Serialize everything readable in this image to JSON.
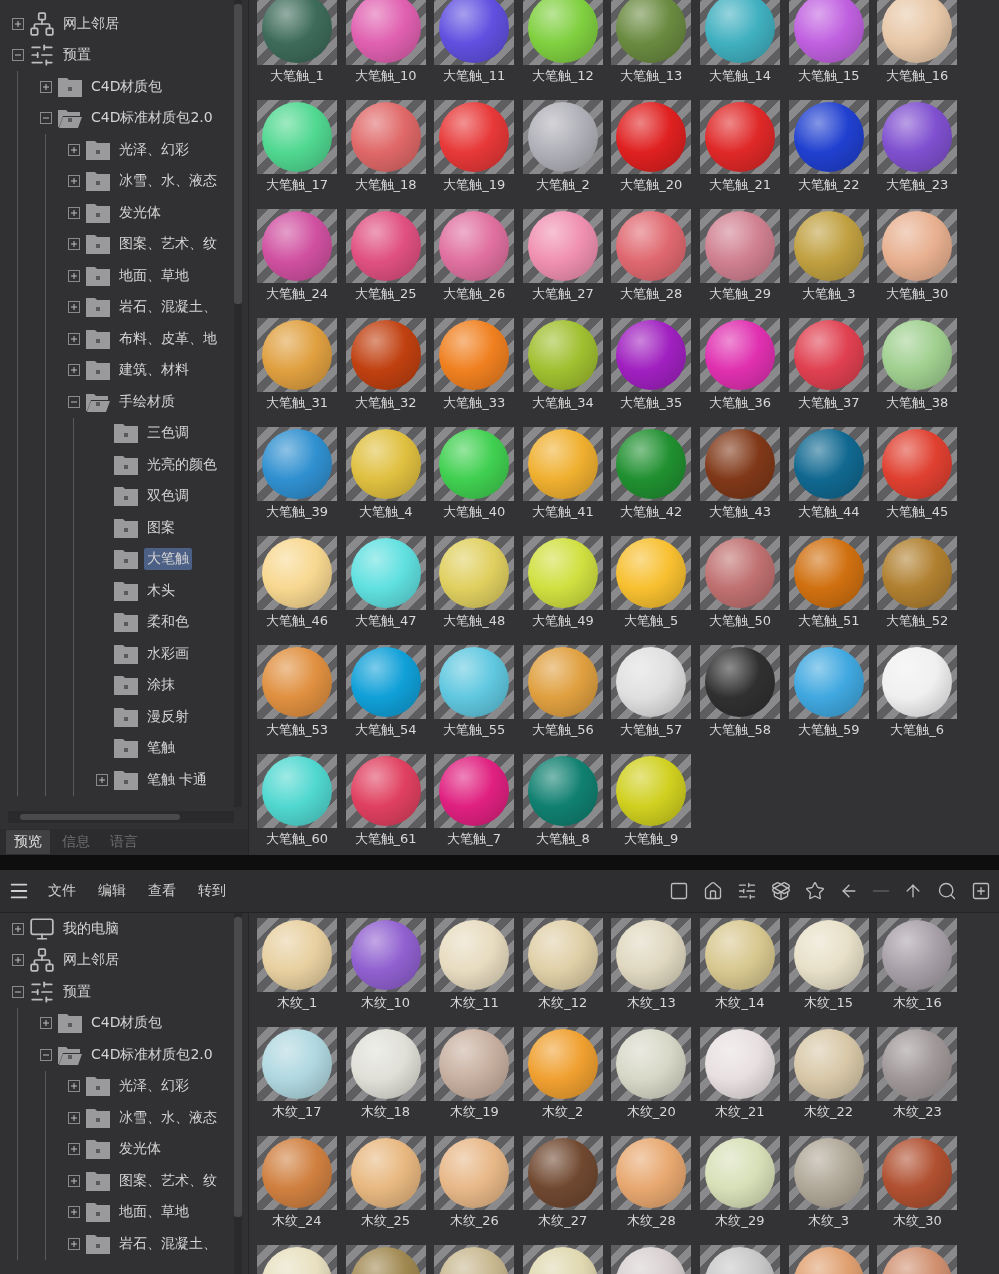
{
  "top_panel": {
    "tree": [
      {
        "label": "网上邻居",
        "kind": "network",
        "expanded": false,
        "selected": false
      },
      {
        "label": "预置",
        "kind": "presets",
        "expanded": true,
        "selected": false,
        "children": [
          {
            "label": "C4D材质包",
            "kind": "folder",
            "expanded": false,
            "selected": false
          },
          {
            "label": "C4D标准材质包2.0",
            "kind": "folder",
            "expanded": true,
            "selected": false,
            "children": [
              {
                "label": "光泽、幻彩",
                "kind": "folder",
                "expanded": false,
                "selected": false
              },
              {
                "label": "冰雪、水、液态",
                "kind": "folder",
                "expanded": false,
                "selected": false
              },
              {
                "label": "发光体",
                "kind": "folder",
                "expanded": false,
                "selected": false
              },
              {
                "label": "图案、艺术、纹",
                "kind": "folder",
                "expanded": false,
                "selected": false
              },
              {
                "label": "地面、草地",
                "kind": "folder",
                "expanded": false,
                "selected": false
              },
              {
                "label": "岩石、混凝土、",
                "kind": "folder",
                "expanded": false,
                "selected": false
              },
              {
                "label": "布料、皮革、地",
                "kind": "folder",
                "expanded": false,
                "selected": false
              },
              {
                "label": "建筑、材料",
                "kind": "folder",
                "expanded": false,
                "selected": false
              },
              {
                "label": "手绘材质",
                "kind": "folder",
                "expanded": true,
                "selected": false,
                "children": [
                  {
                    "label": "三色调",
                    "kind": "folder",
                    "selected": false
                  },
                  {
                    "label": "光亮的颜色",
                    "kind": "folder",
                    "selected": false
                  },
                  {
                    "label": "双色调",
                    "kind": "folder",
                    "selected": false
                  },
                  {
                    "label": "图案",
                    "kind": "folder",
                    "selected": false
                  },
                  {
                    "label": "大笔触",
                    "kind": "folder",
                    "selected": true
                  },
                  {
                    "label": "木头",
                    "kind": "folder",
                    "selected": false
                  },
                  {
                    "label": "柔和色",
                    "kind": "folder",
                    "selected": false
                  },
                  {
                    "label": "水彩画",
                    "kind": "folder",
                    "selected": false
                  },
                  {
                    "label": "涂抹",
                    "kind": "folder",
                    "selected": false
                  },
                  {
                    "label": "漫反射",
                    "kind": "folder",
                    "selected": false
                  },
                  {
                    "label": "笔触",
                    "kind": "folder",
                    "selected": false
                  },
                  {
                    "label": "笔触 卡通",
                    "kind": "folder",
                    "expanded": false,
                    "selected": false
                  }
                ]
              }
            ]
          }
        ]
      }
    ],
    "tabs": [
      {
        "label": "预览",
        "selected": true
      },
      {
        "label": "信息",
        "selected": false
      },
      {
        "label": "语言",
        "selected": false
      }
    ],
    "materials": [
      {
        "label": "大笔触_1",
        "color": "#3d6b5a"
      },
      {
        "label": "大笔触_10",
        "color": "#e060b0"
      },
      {
        "label": "大笔触_11",
        "color": "#6050e0"
      },
      {
        "label": "大笔触_12",
        "color": "#80d040"
      },
      {
        "label": "大笔触_13",
        "color": "#6a8a40"
      },
      {
        "label": "大笔触_14",
        "color": "#40b0c0"
      },
      {
        "label": "大笔触_15",
        "color": "#c060e0"
      },
      {
        "label": "大笔触_16",
        "color": "#e8c8a8"
      },
      {
        "label": "大笔触_17",
        "color": "#50d890"
      },
      {
        "label": "大笔触_18",
        "color": "#e06868"
      },
      {
        "label": "大笔触_19",
        "color": "#e83838"
      },
      {
        "label": "大笔触_2",
        "color": "#b0b0b8"
      },
      {
        "label": "大笔触_20",
        "color": "#e02020"
      },
      {
        "label": "大笔触_21",
        "color": "#e02828"
      },
      {
        "label": "大笔触_22",
        "color": "#2040d0"
      },
      {
        "label": "大笔触_23",
        "color": "#8050d0"
      },
      {
        "label": "大笔触_24",
        "color": "#d050a0"
      },
      {
        "label": "大笔触_25",
        "color": "#e05080"
      },
      {
        "label": "大笔触_26",
        "color": "#e070a0"
      },
      {
        "label": "大笔触_27",
        "color": "#f090b0"
      },
      {
        "label": "大笔触_28",
        "color": "#e06870"
      },
      {
        "label": "大笔触_29",
        "color": "#d08090"
      },
      {
        "label": "大笔触_3",
        "color": "#c0a040"
      },
      {
        "label": "大笔触_30",
        "color": "#e8b090"
      },
      {
        "label": "大笔触_31",
        "color": "#e0a040"
      },
      {
        "label": "大笔触_32",
        "color": "#c04010"
      },
      {
        "label": "大笔触_33",
        "color": "#f08020"
      },
      {
        "label": "大笔触_34",
        "color": "#a0c030"
      },
      {
        "label": "大笔触_35",
        "color": "#a020c0"
      },
      {
        "label": "大笔触_36",
        "color": "#e030b0"
      },
      {
        "label": "大笔触_37",
        "color": "#e04050"
      },
      {
        "label": "大笔触_38",
        "color": "#a0d090"
      },
      {
        "label": "大笔触_39",
        "color": "#3090d0"
      },
      {
        "label": "大笔触_4",
        "color": "#e0c040"
      },
      {
        "label": "大笔触_40",
        "color": "#40d050"
      },
      {
        "label": "大笔触_41",
        "color": "#f0b030"
      },
      {
        "label": "大笔触_42",
        "color": "#209030"
      },
      {
        "label": "大笔触_43",
        "color": "#803818"
      },
      {
        "label": "大笔触_44",
        "color": "#106890"
      },
      {
        "label": "大笔触_45",
        "color": "#e04030"
      },
      {
        "label": "大笔触_46",
        "color": "#f8d890"
      },
      {
        "label": "大笔触_47",
        "color": "#60e0e0"
      },
      {
        "label": "大笔触_48",
        "color": "#e0d060"
      },
      {
        "label": "大笔触_49",
        "color": "#d0e040"
      },
      {
        "label": "大笔触_5",
        "color": "#f8c030"
      },
      {
        "label": "大笔触_50",
        "color": "#c07070"
      },
      {
        "label": "大笔触_51",
        "color": "#d07010"
      },
      {
        "label": "大笔触_52",
        "color": "#b08030"
      },
      {
        "label": "大笔触_53",
        "color": "#e09040"
      },
      {
        "label": "大笔触_54",
        "color": "#10a0d8"
      },
      {
        "label": "大笔触_55",
        "color": "#60c8e0"
      },
      {
        "label": "大笔触_56",
        "color": "#e0a040"
      },
      {
        "label": "大笔触_57",
        "color": "#e0e0e0"
      },
      {
        "label": "大笔触_58",
        "color": "#303030"
      },
      {
        "label": "大笔触_59",
        "color": "#40a8e0"
      },
      {
        "label": "大笔触_6",
        "color": "#f0f0f0"
      },
      {
        "label": "大笔触_60",
        "color": "#50d8d0"
      },
      {
        "label": "大笔触_61",
        "color": "#e04060"
      },
      {
        "label": "大笔触_7",
        "color": "#e02080"
      },
      {
        "label": "大笔触_8",
        "color": "#108070"
      },
      {
        "label": "大笔触_9",
        "color": "#d0d020"
      }
    ]
  },
  "bottom_panel": {
    "menu": [
      "文件",
      "编辑",
      "查看",
      "转到"
    ],
    "tree": [
      {
        "label": "我的电脑",
        "kind": "computer",
        "expanded": false,
        "selected": false
      },
      {
        "label": "网上邻居",
        "kind": "network",
        "expanded": false,
        "selected": false
      },
      {
        "label": "预置",
        "kind": "presets",
        "expanded": true,
        "selected": false,
        "children": [
          {
            "label": "C4D材质包",
            "kind": "folder",
            "expanded": false,
            "selected": false
          },
          {
            "label": "C4D标准材质包2.0",
            "kind": "folder",
            "expanded": true,
            "selected": false,
            "children": [
              {
                "label": "光泽、幻彩",
                "kind": "folder",
                "expanded": false,
                "selected": false
              },
              {
                "label": "冰雪、水、液态",
                "kind": "folder",
                "expanded": false,
                "selected": false
              },
              {
                "label": "发光体",
                "kind": "folder",
                "expanded": false,
                "selected": false
              },
              {
                "label": "图案、艺术、纹",
                "kind": "folder",
                "expanded": false,
                "selected": false
              },
              {
                "label": "地面、草地",
                "kind": "folder",
                "expanded": false,
                "selected": false
              },
              {
                "label": "岩石、混凝土、",
                "kind": "folder",
                "expanded": false,
                "selected": false
              }
            ]
          }
        ]
      }
    ],
    "materials": [
      {
        "label": "木纹_1",
        "color": "#e8d0a0"
      },
      {
        "label": "木纹_10",
        "color": "#9060d0"
      },
      {
        "label": "木纹_11",
        "color": "#e8dcc0"
      },
      {
        "label": "木纹_12",
        "color": "#e0d0a8"
      },
      {
        "label": "木纹_13",
        "color": "#e0d8c0"
      },
      {
        "label": "木纹_14",
        "color": "#d8c890"
      },
      {
        "label": "木纹_15",
        "color": "#e8e0c8"
      },
      {
        "label": "木纹_16",
        "color": "#a8a0a8"
      },
      {
        "label": "木纹_17",
        "color": "#b0d8e0"
      },
      {
        "label": "木纹_18",
        "color": "#e0e0d8"
      },
      {
        "label": "木纹_19",
        "color": "#c8b0a0"
      },
      {
        "label": "木纹_2",
        "color": "#f0a030"
      },
      {
        "label": "木纹_20",
        "color": "#d8d8c8"
      },
      {
        "label": "木纹_21",
        "color": "#e8e0e0"
      },
      {
        "label": "木纹_22",
        "color": "#d8c8a8"
      },
      {
        "label": "木纹_23",
        "color": "#a09898"
      },
      {
        "label": "木纹_24",
        "color": "#d08040"
      },
      {
        "label": "木纹_25",
        "color": "#e8b880"
      },
      {
        "label": "木纹_26",
        "color": "#e8b888"
      },
      {
        "label": "木纹_27",
        "color": "#704830"
      },
      {
        "label": "木纹_28",
        "color": "#e8a870"
      },
      {
        "label": "木纹_29",
        "color": "#d8e0b8"
      },
      {
        "label": "木纹_3",
        "color": "#b0a898"
      },
      {
        "label": "木纹_30",
        "color": "#b05030"
      },
      {
        "color": "#e8e0c0"
      },
      {
        "color": "#a08850"
      },
      {
        "color": "#c8b890"
      },
      {
        "color": "#e0d8b0"
      },
      {
        "color": "#d8d0d0"
      },
      {
        "color": "#c8c8c8"
      },
      {
        "color": "#e0a070"
      },
      {
        "color": "#d09070"
      }
    ]
  }
}
